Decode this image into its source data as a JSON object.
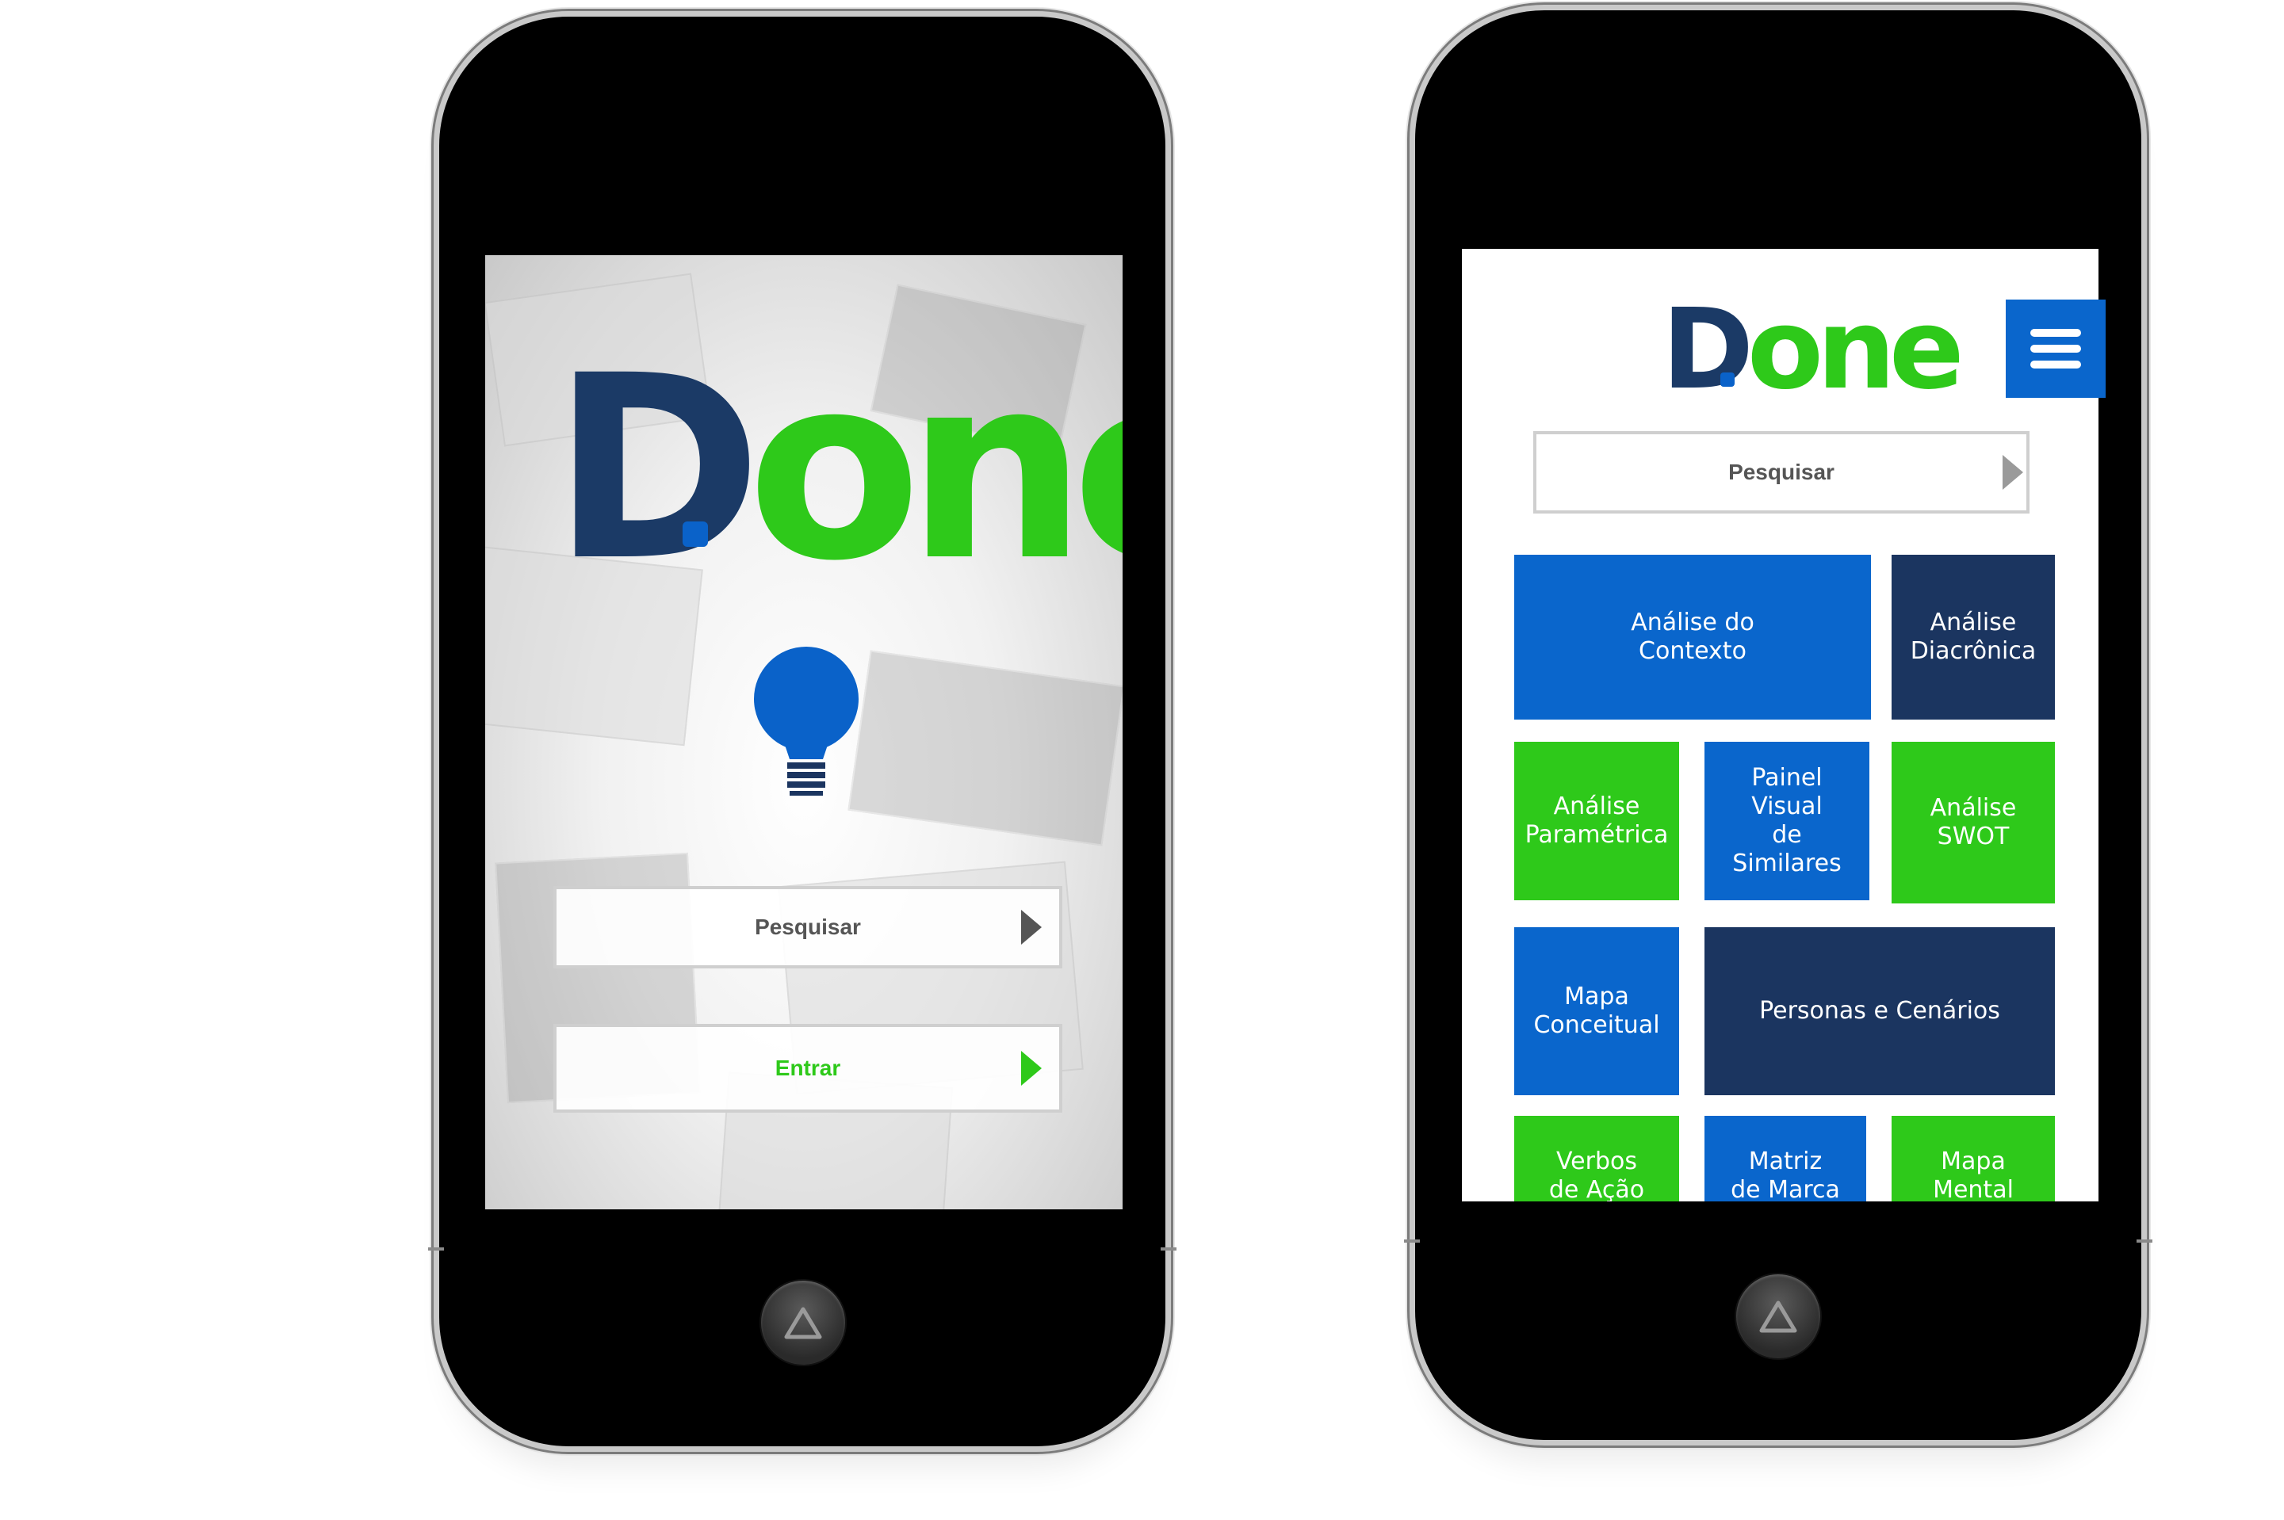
{
  "colors": {
    "brand_navy": "#1b3a66",
    "brand_green": "#2ec91a",
    "brand_blue": "#0a66cc",
    "tile_navy": "#1b3560"
  },
  "left_screen": {
    "logo": {
      "d": "D",
      "one": "one"
    },
    "bulb_icon": "lightbulb-icon",
    "search": {
      "label": "Pesquisar"
    },
    "enter": {
      "label": "Entrar"
    }
  },
  "right_screen": {
    "logo": {
      "d": "D",
      "one": "one"
    },
    "menu_icon": "hamburger-menu-icon",
    "search": {
      "label": "Pesquisar"
    },
    "tiles": [
      {
        "label": "Análise do\nContexto",
        "color": "blue"
      },
      {
        "label": "Análise\nDiacrônica",
        "color": "navy"
      },
      {
        "label": "Análise\nParamétrica",
        "color": "green"
      },
      {
        "label": "Painel Visual\nde Similares",
        "color": "blue"
      },
      {
        "label": "Análise\nSWOT",
        "color": "green"
      },
      {
        "label": "Mapa\nConceitual",
        "color": "blue"
      },
      {
        "label": "Personas e Cenários",
        "color": "navy"
      },
      {
        "label": "Verbos\nde Ação",
        "color": "green"
      },
      {
        "label": "Matriz\nde Marca",
        "color": "blue"
      },
      {
        "label": "Mapa\nMental",
        "color": "green"
      }
    ]
  }
}
